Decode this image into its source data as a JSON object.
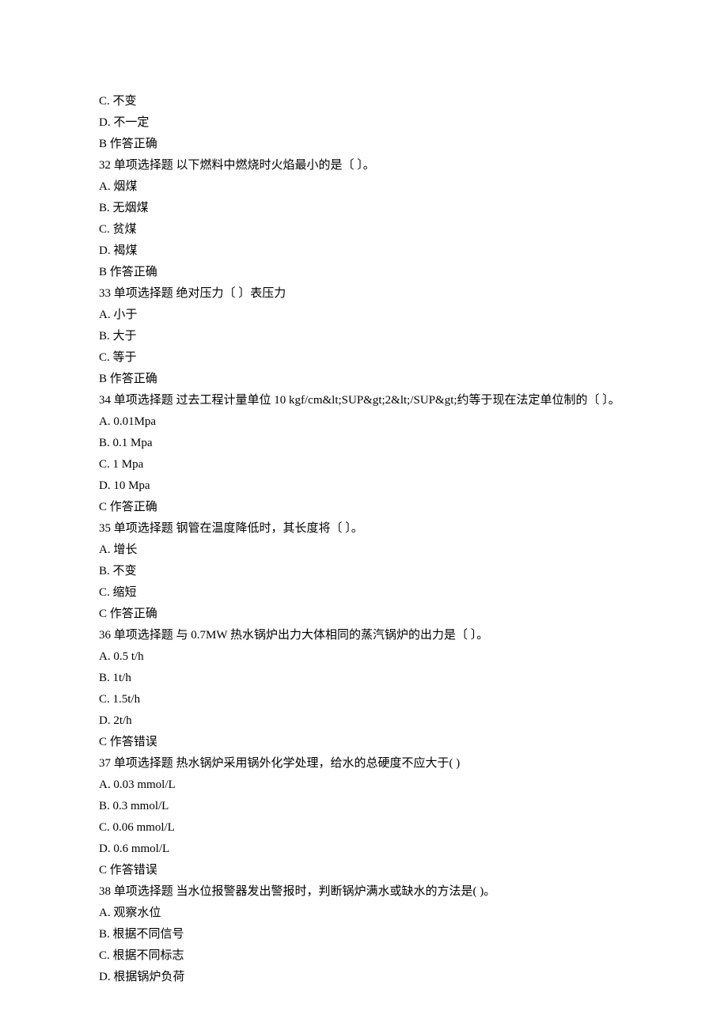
{
  "lines": [
    {
      "text": "C.   不变",
      "class": "indent-1"
    },
    {
      "text": "D.  不一定",
      "class": "indent-1"
    },
    {
      "text": "B  作答正确",
      "class": "indent-1"
    },
    {
      "text": "32  单项选择题  以下燃料中燃烧时火焰最小的是〔          〕。",
      "class": "indent-1"
    },
    {
      "text": "A.  烟煤",
      "class": "indent-1"
    },
    {
      "text": "B.  无烟煤",
      "class": "indent-1"
    },
    {
      "text": "C.  贫煤",
      "class": "indent-1"
    },
    {
      "text": "D.  褐煤",
      "class": "indent-1"
    },
    {
      "text": "B  作答正确",
      "class": "indent-1"
    },
    {
      "text": "33  单项选择题  绝对压力〔          〕表压力",
      "class": "indent-1"
    },
    {
      "text": "A.  小于",
      "class": "indent-1"
    },
    {
      "text": "B.  大于",
      "class": "indent-1"
    },
    {
      "text": "C.  等于",
      "class": "indent-1"
    },
    {
      "text": "B  作答正确",
      "class": "indent-1"
    },
    {
      "text": "34  单项选择题  过去工程计量单位 10 kgf/cm&lt;SUP&gt;2&lt;/SUP&gt;约等于现在法定单位制的〔          〕。",
      "class": "wrap"
    },
    {
      "text": "A. 0.01Mpa",
      "class": "indent-1"
    },
    {
      "text": "B. 0.1 Mpa",
      "class": "indent-1"
    },
    {
      "text": "C. 1 Mpa",
      "class": "indent-1"
    },
    {
      "text": "D. 10 Mpa",
      "class": "indent-1"
    },
    {
      "text": "C  作答正确",
      "class": "indent-1"
    },
    {
      "text": "35  单项选择题  钢管在温度降低时，其长度将〔          〕。",
      "class": "indent-1"
    },
    {
      "text": "A.  增长",
      "class": "indent-1"
    },
    {
      "text": "B.  不变",
      "class": "indent-1"
    },
    {
      "text": "C.  缩短",
      "class": "indent-1"
    },
    {
      "text": "C  作答正确",
      "class": "indent-1"
    },
    {
      "text": "36  单项选择题  与 0.7MW 热水锅炉出力大体相同的蒸汽锅炉的出力是〔          〕。",
      "class": "indent-1"
    },
    {
      "text": "A. 0.5 t/h",
      "class": "indent-1"
    },
    {
      "text": "B. 1t/h",
      "class": "indent-1"
    },
    {
      "text": "C. 1.5t/h",
      "class": "indent-1"
    },
    {
      "text": "D. 2t/h",
      "class": "indent-1"
    },
    {
      "text": "C  作答错误",
      "class": "indent-1"
    },
    {
      "text": "37  单项选择题  热水锅炉采用锅外化学处理，给水的总硬度不应大于(            )",
      "class": "indent-1"
    },
    {
      "text": "A. 0.03 mmol/L",
      "class": "indent-1"
    },
    {
      "text": "B. 0.3 mmol/L",
      "class": "indent-1"
    },
    {
      "text": "C. 0.06 mmol/L",
      "class": "indent-1"
    },
    {
      "text": "D. 0.6 mmol/L",
      "class": "indent-1"
    },
    {
      "text": "C  作答错误",
      "class": "indent-1"
    },
    {
      "text": "38  单项选择题  当水位报警器发出警报时，判断锅炉满水或缺水的方法是(            )。",
      "class": "indent-1"
    },
    {
      "text": " ",
      "class": "indent-1"
    },
    {
      "text": "A.  观察水位",
      "class": "indent-1"
    },
    {
      "text": "B.  根据不同信号",
      "class": "indent-1"
    },
    {
      "text": "C.  根据不同标志",
      "class": "indent-1"
    },
    {
      "text": "D.  根据锅炉负荷",
      "class": "indent-1"
    }
  ]
}
